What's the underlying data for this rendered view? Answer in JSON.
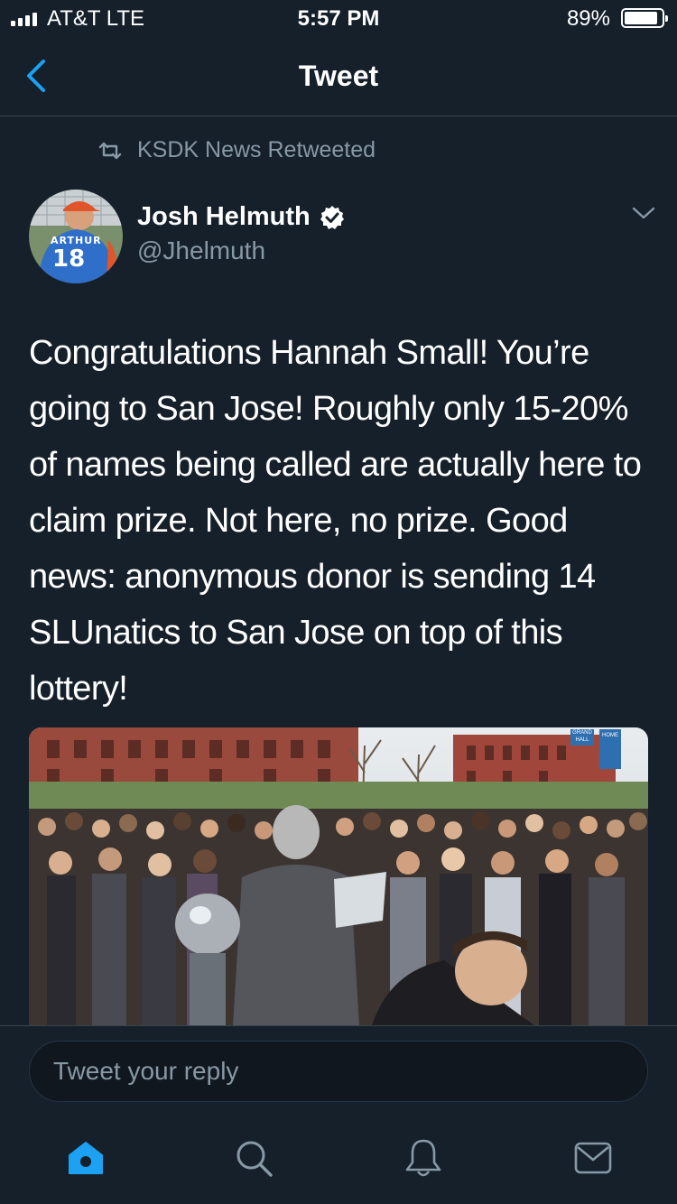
{
  "status_bar": {
    "carrier": "AT&T  LTE",
    "time": "5:57 PM",
    "battery_percent_text": "89%",
    "battery_level": 0.89
  },
  "nav": {
    "title": "Tweet",
    "back_icon": "chevron-left-icon"
  },
  "retweet": {
    "icon": "retweet-icon",
    "text": "KSDK News Retweeted"
  },
  "author": {
    "name": "Josh Helmuth",
    "handle": "@Jhelmuth",
    "verified": true,
    "avatar_jersey_name": "ARTHUR",
    "avatar_jersey_number": "18"
  },
  "tweet": {
    "text": "Congratulations Hannah Small! You’re going to San Jose! Roughly only 15-20% of names being called are actually here to claim prize. Not here, no prize. Good news: anonymous donor is sending 14 SLUnatics to San Jose on top of this lottery!"
  },
  "media": {
    "sign_top": "GRAND HALL",
    "sign_right": "HOME"
  },
  "reply": {
    "placeholder": "Tweet your reply"
  },
  "tabs": [
    {
      "name": "home",
      "icon": "home-icon",
      "active": true
    },
    {
      "name": "search",
      "icon": "search-icon",
      "active": false
    },
    {
      "name": "notifications",
      "icon": "bell-icon",
      "active": false
    },
    {
      "name": "messages",
      "icon": "mail-icon",
      "active": false
    }
  ],
  "colors": {
    "background": "#15202b",
    "accent": "#1da1f2",
    "secondary_text": "#8899a6",
    "divider": "#38444d"
  }
}
